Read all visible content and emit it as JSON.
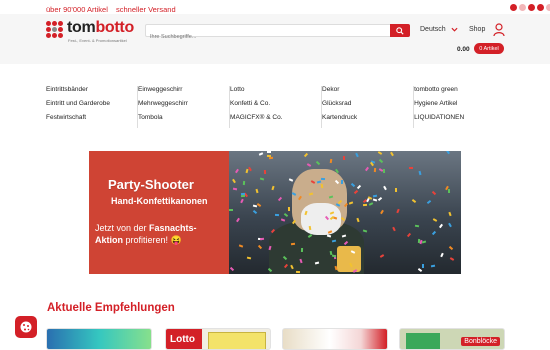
{
  "topbar": {
    "articles": "über 90'000 Artikel",
    "shipping": "schneller Versand"
  },
  "header": {
    "logo_main": "tom",
    "logo_accent": "botto",
    "logo_sub": "Fest-, Event- & Promotionsartikel",
    "search_placeholder": "Ihre Suchbegriffe...",
    "language": "Deutsch",
    "shop_label": "Shop",
    "cart_total": "0.00",
    "cart_label": "0 Artikel"
  },
  "menu": [
    [
      "Eintrittsbänder",
      "Eintritt und Garderobe",
      "Festwirtschaft"
    ],
    [
      "Einweggeschirr",
      "Mehrweggeschirr",
      "Tombola"
    ],
    [
      "Lotto",
      "Konfetti & Co.",
      "MAGICFX® & Co."
    ],
    [
      "Dekor",
      "Glücksrad",
      "Kartendruck"
    ],
    [
      "tombotto green",
      "Hygiene Artikel",
      "LIQUIDATIONEN"
    ]
  ],
  "banner": {
    "title": "Party-Shooter",
    "subtitle": "Hand-Konfettikanonen",
    "line1": "Jetzt von der ",
    "line1_bold": "Fasnachts-",
    "line2_bold": "Aktion",
    "line2": " profitieren! 😝"
  },
  "section_title": "Aktuelle Empfehlungen",
  "cards": [
    {
      "label": ""
    },
    {
      "label": "Lotto"
    },
    {
      "label": ""
    },
    {
      "label": "Bonblöcke"
    }
  ],
  "colors": {
    "brand": "#d32027",
    "header_bg": "#f6f6f6"
  }
}
